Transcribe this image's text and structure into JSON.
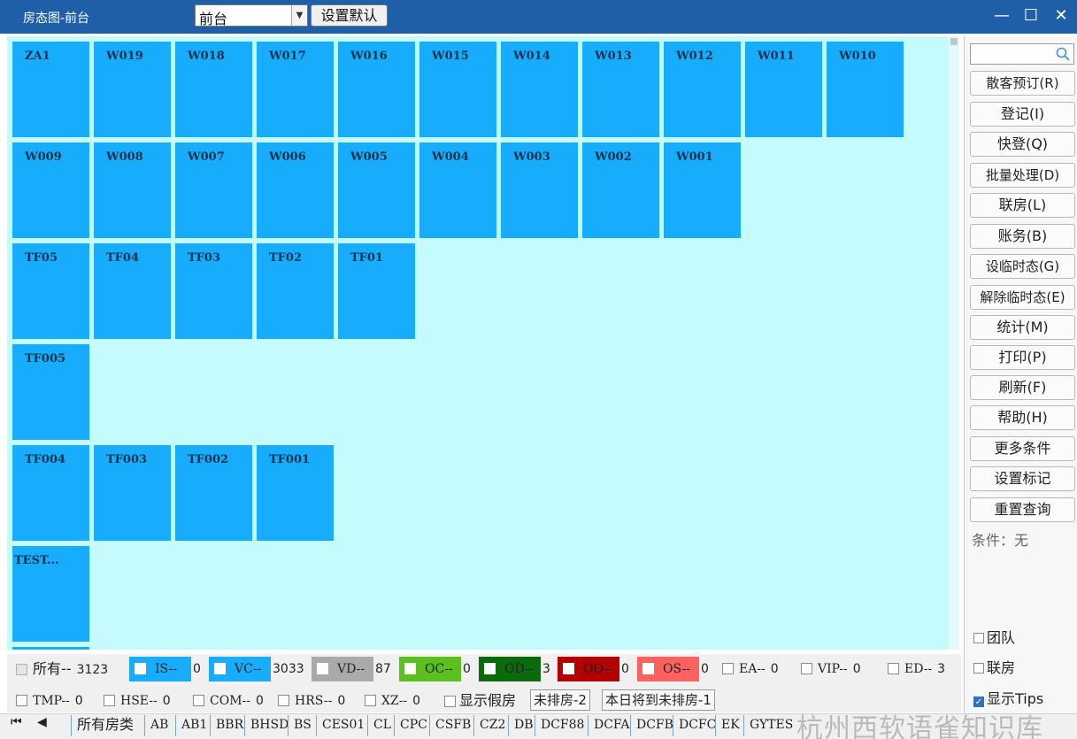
{
  "titlebar": {
    "title": "房态图-前台",
    "location_select": "前台",
    "set_default_label": "设置默认",
    "minimize": "—",
    "maximize": "☐",
    "close": "✕"
  },
  "rooms": [
    [
      "ZA1",
      "W019",
      "W018",
      "W017",
      "W016",
      "W015",
      "W014",
      "W013",
      "W012",
      "W011",
      "W010"
    ],
    [
      "W009",
      "W008",
      "W007",
      "W006",
      "W005",
      "W004",
      "W003",
      "W002",
      "W001"
    ],
    [
      "TF05",
      "TF04",
      "TF03",
      "TF02",
      "TF01"
    ],
    [
      "TF005"
    ],
    [
      "TF004",
      "TF003",
      "TF002",
      "TF001"
    ],
    [
      "TEST..."
    ]
  ],
  "room_color": "#18acfc",
  "sidebar": {
    "buttons": [
      "散客预订(R)",
      "登记(I)",
      "快登(Q)",
      "批量处理(D)",
      "联房(L)",
      "账务(B)",
      "设临时态(G)",
      "解除临时态(E)",
      "统计(M)",
      "打印(P)",
      "刷新(F)",
      "帮助(H)",
      "更多条件",
      "设置标记",
      "重置查询"
    ],
    "condition": "条件：无",
    "checks": [
      {
        "label": "团队",
        "checked": false
      },
      {
        "label": "联房",
        "checked": false
      },
      {
        "label": "显示Tips",
        "checked": true
      }
    ]
  },
  "legend": {
    "all": {
      "label": "所有--",
      "count": "3123"
    },
    "status": [
      {
        "label": "IS--",
        "count": "0",
        "color": "#18acfc"
      },
      {
        "label": "VC--",
        "count": "3033",
        "color": "#18acfc"
      },
      {
        "label": "VD--",
        "count": "87",
        "color": "#aaaaaa"
      },
      {
        "label": "OC--",
        "count": "0",
        "color": "#5bbf1f"
      },
      {
        "label": "OD--",
        "count": "3",
        "color": "#0b6a0b"
      },
      {
        "label": "OO--",
        "count": "0",
        "color": "#b30000"
      },
      {
        "label": "OS--",
        "count": "0",
        "color": "#ff6060"
      }
    ],
    "plain_row1": [
      {
        "label": "EA--",
        "count": "0"
      },
      {
        "label": "VIP--",
        "count": "0"
      },
      {
        "label": "ED--",
        "count": "3"
      }
    ],
    "plain_row2": [
      {
        "label": "TMP--",
        "count": "0"
      },
      {
        "label": "HSE--",
        "count": "0"
      },
      {
        "label": "COM--",
        "count": "0"
      },
      {
        "label": "HRS--",
        "count": "0"
      },
      {
        "label": "XZ--",
        "count": "0"
      }
    ],
    "show_fake": "显示假房",
    "unassigned": "未排房-2",
    "today_unassigned": "本日将到未排房-1"
  },
  "tabs": [
    "所有房类",
    "AB",
    "AB1",
    "BBR",
    "BHSD",
    "BS",
    "CES01",
    "CL",
    "CPC",
    "CSFB",
    "CZ2",
    "DB",
    "DCF88",
    "DCFA",
    "DCFB",
    "DCFC",
    "EK",
    "GYTES"
  ],
  "watermark": "杭州西软语雀知识库"
}
